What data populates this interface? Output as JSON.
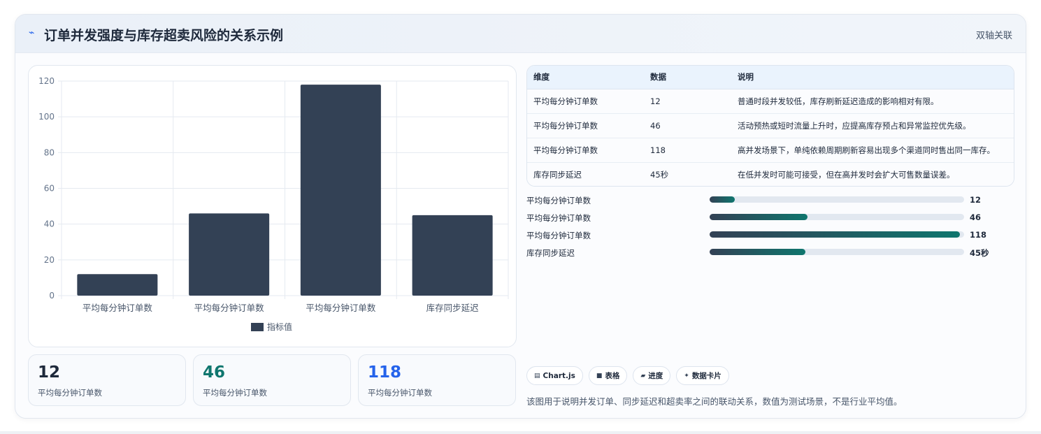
{
  "header": {
    "title": "订单并发强度与库存超卖风险的关系示例",
    "mode": "双轴关联"
  },
  "chart_data": {
    "type": "bar",
    "categories": [
      "平均每分钟订单数",
      "平均每分钟订单数",
      "平均每分钟订单数",
      "库存同步延迟"
    ],
    "series": [
      {
        "name": "指标值",
        "values": [
          12,
          46,
          118,
          45
        ],
        "color": "#334155"
      }
    ],
    "yticks": [
      0,
      20,
      40,
      60,
      80,
      100,
      120
    ],
    "ylim": [
      0,
      120
    ],
    "grid": true,
    "legend": "bottom"
  },
  "stats": [
    {
      "value": "12",
      "label": "平均每分钟订单数",
      "color": "#1e293b"
    },
    {
      "value": "46",
      "label": "平均每分钟订单数",
      "color": "#0f766e"
    },
    {
      "value": "118",
      "label": "平均每分钟订单数",
      "color": "#2563eb"
    }
  ],
  "table": {
    "headers": [
      "维度",
      "数据",
      "说明"
    ],
    "rows": [
      [
        "平均每分钟订单数",
        "12",
        "普通时段并发较低，库存刷新延迟造成的影响相对有限。"
      ],
      [
        "平均每分钟订单数",
        "46",
        "活动预热或短时流量上升时，应提高库存预占和异常监控优先级。"
      ],
      [
        "平均每分钟订单数",
        "118",
        "高并发场景下，单纯依赖周期刷新容易出现多个渠道同时售出同一库存。"
      ],
      [
        "库存同步延迟",
        "45秒",
        "在低并发时可能可接受，但在高并发时会扩大可售数量误差。"
      ]
    ]
  },
  "progress": {
    "max": 120,
    "items": [
      {
        "label": "平均每分钟订单数",
        "value": 12,
        "display": "12"
      },
      {
        "label": "平均每分钟订单数",
        "value": 46,
        "display": "46"
      },
      {
        "label": "平均每分钟订单数",
        "value": 118,
        "display": "118"
      },
      {
        "label": "库存同步延迟",
        "value": 45,
        "display": "45秒"
      }
    ]
  },
  "chips": [
    {
      "icon": "chart-icon",
      "glyph": "▤",
      "label": "Chart.js"
    },
    {
      "icon": "table-icon",
      "glyph": "■",
      "label": "表格"
    },
    {
      "icon": "progress-icon",
      "glyph": "▰",
      "label": "进度"
    },
    {
      "icon": "sparkle-icon",
      "glyph": "✦",
      "label": "数据卡片"
    }
  ],
  "note": "该图用于说明并发订单、同步延迟和超卖率之间的联动关系，数值为测试场景，不是行业平均值。"
}
